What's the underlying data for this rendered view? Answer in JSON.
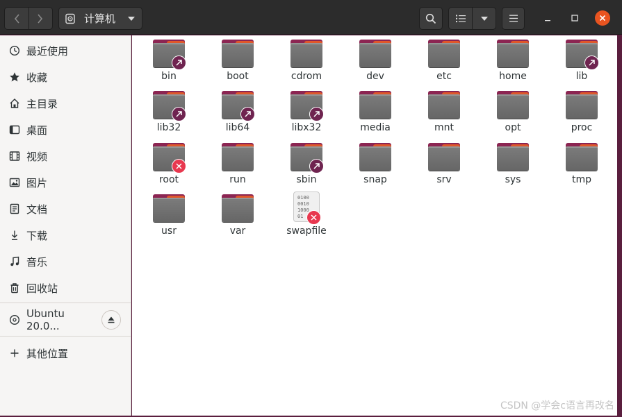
{
  "header": {
    "path_label": "计算机"
  },
  "sidebar": {
    "items": [
      {
        "label": "最近使用",
        "icon": "clock-icon"
      },
      {
        "label": "收藏",
        "icon": "star-icon"
      },
      {
        "label": "主目录",
        "icon": "home-icon"
      },
      {
        "label": "桌面",
        "icon": "desktop-icon"
      },
      {
        "label": "视频",
        "icon": "video-icon"
      },
      {
        "label": "图片",
        "icon": "image-icon"
      },
      {
        "label": "文档",
        "icon": "document-icon"
      },
      {
        "label": "下载",
        "icon": "download-icon"
      },
      {
        "label": "音乐",
        "icon": "music-icon"
      },
      {
        "label": "回收站",
        "icon": "trash-icon"
      }
    ],
    "device": {
      "label": "Ubuntu 20.0...",
      "icon": "disc-icon"
    },
    "other": {
      "label": "其他位置",
      "icon": "plus-icon"
    }
  },
  "files": [
    {
      "name": "bin",
      "type": "folder",
      "emblem": "link"
    },
    {
      "name": "boot",
      "type": "folder",
      "emblem": ""
    },
    {
      "name": "cdrom",
      "type": "folder",
      "emblem": ""
    },
    {
      "name": "dev",
      "type": "folder",
      "emblem": ""
    },
    {
      "name": "etc",
      "type": "folder",
      "emblem": ""
    },
    {
      "name": "home",
      "type": "folder",
      "emblem": ""
    },
    {
      "name": "lib",
      "type": "folder",
      "emblem": "link"
    },
    {
      "name": "lib32",
      "type": "folder",
      "emblem": "link"
    },
    {
      "name": "lib64",
      "type": "folder",
      "emblem": "link"
    },
    {
      "name": "libx32",
      "type": "folder",
      "emblem": "link"
    },
    {
      "name": "media",
      "type": "folder",
      "emblem": ""
    },
    {
      "name": "mnt",
      "type": "folder",
      "emblem": ""
    },
    {
      "name": "opt",
      "type": "folder",
      "emblem": ""
    },
    {
      "name": "proc",
      "type": "folder",
      "emblem": ""
    },
    {
      "name": "root",
      "type": "folder",
      "emblem": "x"
    },
    {
      "name": "run",
      "type": "folder",
      "emblem": ""
    },
    {
      "name": "sbin",
      "type": "folder",
      "emblem": "link"
    },
    {
      "name": "snap",
      "type": "folder",
      "emblem": ""
    },
    {
      "name": "srv",
      "type": "folder",
      "emblem": ""
    },
    {
      "name": "sys",
      "type": "folder",
      "emblem": ""
    },
    {
      "name": "tmp",
      "type": "folder",
      "emblem": ""
    },
    {
      "name": "usr",
      "type": "folder",
      "emblem": ""
    },
    {
      "name": "var",
      "type": "folder",
      "emblem": ""
    },
    {
      "name": "swapfile",
      "type": "binary-file",
      "emblem": "x"
    }
  ],
  "watermark": "CSDN @学会c语言再改名",
  "colors": {
    "accent": "#e95420",
    "folder_tab": "#8c2552",
    "folder_body": "#737373",
    "link_emblem": "#6f2450",
    "no_access_emblem": "#e8384f"
  }
}
